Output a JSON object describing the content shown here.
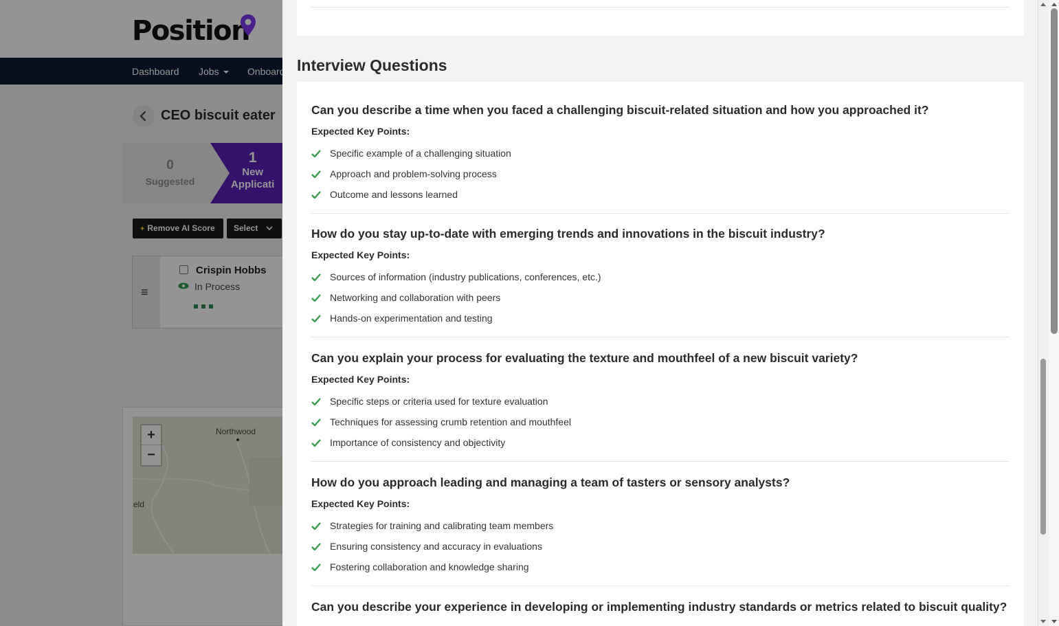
{
  "app": {
    "logo_text": "Position",
    "nav": [
      {
        "label": "Dashboard"
      },
      {
        "label": "Jobs"
      },
      {
        "label": "Onboard"
      }
    ],
    "job_title": "CEO biscuit eater",
    "stages": {
      "suggested": {
        "count": "0",
        "label": "Suggested"
      },
      "new": {
        "count": "1",
        "label_line1": "New",
        "label_line2": "Applicati"
      }
    },
    "toolbar": {
      "remove_ai_score": "Remove AI Score",
      "select": "Select"
    },
    "candidate": {
      "name": "Crispin Hobbs",
      "status": "In Process"
    },
    "map": {
      "zoom_in": "+",
      "zoom_out": "−",
      "labels": [
        "Northwood",
        "eld"
      ]
    }
  },
  "panel": {
    "section_title": "Interview Questions",
    "expected_label": "Expected Key Points:",
    "questions": [
      {
        "question": "Can you describe a time when you faced a challenging biscuit-related situation and how you approached it?",
        "points": [
          "Specific example of a challenging situation",
          "Approach and problem-solving process",
          "Outcome and lessons learned"
        ]
      },
      {
        "question": "How do you stay up-to-date with emerging trends and innovations in the biscuit industry?",
        "points": [
          "Sources of information (industry publications, conferences, etc.)",
          "Networking and collaboration with peers",
          "Hands-on experimentation and testing"
        ]
      },
      {
        "question": "Can you explain your process for evaluating the texture and mouthfeel of a new biscuit variety?",
        "points": [
          "Specific steps or criteria used for texture evaluation",
          "Techniques for assessing crumb retention and mouthfeel",
          "Importance of consistency and objectivity"
        ]
      },
      {
        "question": "How do you approach leading and managing a team of tasters or sensory analysts?",
        "points": [
          "Strategies for training and calibrating team members",
          "Ensuring consistency and accuracy in evaluations",
          "Fostering collaboration and knowledge sharing"
        ]
      },
      {
        "question": "Can you describe your experience in developing or implementing industry standards or metrics related to biscuit quality?",
        "points": []
      }
    ]
  },
  "colors": {
    "brand_purple": "#5c22b8",
    "nav_dark": "#0c1a33",
    "check_green": "#3a9a4e"
  }
}
